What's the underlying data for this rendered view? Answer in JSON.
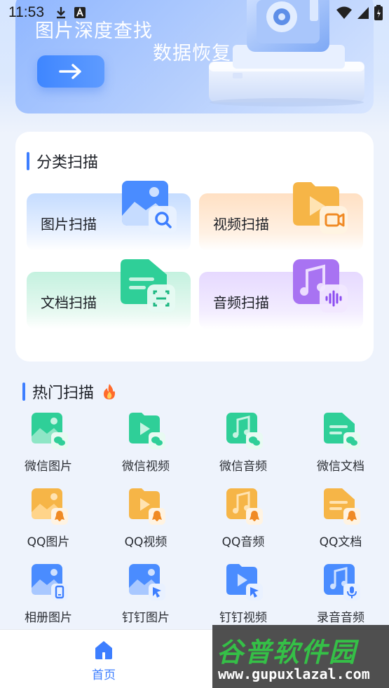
{
  "status_bar": {
    "time": "11:53"
  },
  "banner": {
    "title_line1": "图片深度查找",
    "title_line2": "数据恢复"
  },
  "category": {
    "title": "分类扫描",
    "tiles": [
      {
        "label": "图片扫描"
      },
      {
        "label": "视频扫描"
      },
      {
        "label": "文档扫描"
      },
      {
        "label": "音频扫描"
      }
    ]
  },
  "hot": {
    "title": "热门扫描",
    "items": [
      {
        "label": "微信图片"
      },
      {
        "label": "微信视频"
      },
      {
        "label": "微信音频"
      },
      {
        "label": "微信文档"
      },
      {
        "label": "QQ图片"
      },
      {
        "label": "QQ视频"
      },
      {
        "label": "QQ音频"
      },
      {
        "label": "QQ文档"
      },
      {
        "label": "相册图片"
      },
      {
        "label": "钉钉图片"
      },
      {
        "label": "钉钉视频"
      },
      {
        "label": "录音音频"
      }
    ]
  },
  "nav": {
    "home_label": "首页"
  },
  "watermark": {
    "brand": "谷普软件园",
    "url": "www.gupuxlazal.com"
  },
  "colors": {
    "accent": "#3d7eff",
    "green": "#2fcf98",
    "orange": "#f4a935",
    "purple": "#a873f2"
  }
}
